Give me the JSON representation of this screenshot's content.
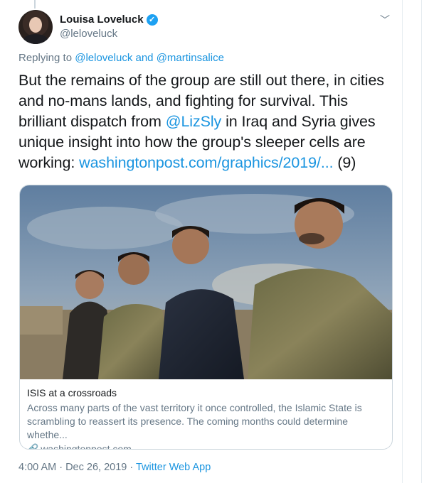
{
  "author": {
    "display_name": "Louisa Loveluck",
    "handle": "@leloveluck",
    "verified_glyph": "✓"
  },
  "reply": {
    "prefix": "Replying to ",
    "user1": "@leloveluck",
    "conj": " and ",
    "user2": "@martinsalice"
  },
  "tweet": {
    "part1": "But the remains of the group are still out there, in cities and no-mans lands, and fighting for survival. This brilliant dispatch from ",
    "mention": "@LizSly",
    "part2": " in Iraq and Syria gives unique insight into how the group's sleeper cells are working: ",
    "url": "washingtonpost.com/graphics/2019/...",
    "suffix": " (9)"
  },
  "card": {
    "title": "ISIS at a crossroads",
    "description": "Across many parts of the vast territory it once controlled, the Islamic State is scrambling to reassert its presence. The coming months could determine whethe...",
    "domain": "washingtonpost.com",
    "link_icon": "🔗"
  },
  "footer": {
    "time_date": "4:00 AM · Dec 26, 2019 · ",
    "app": "Twitter Web App"
  },
  "icons": {
    "chevron": "﹀"
  },
  "colors": {
    "link": "#1b95e0",
    "secondary": "#657786",
    "verified": "#1da1f2"
  }
}
